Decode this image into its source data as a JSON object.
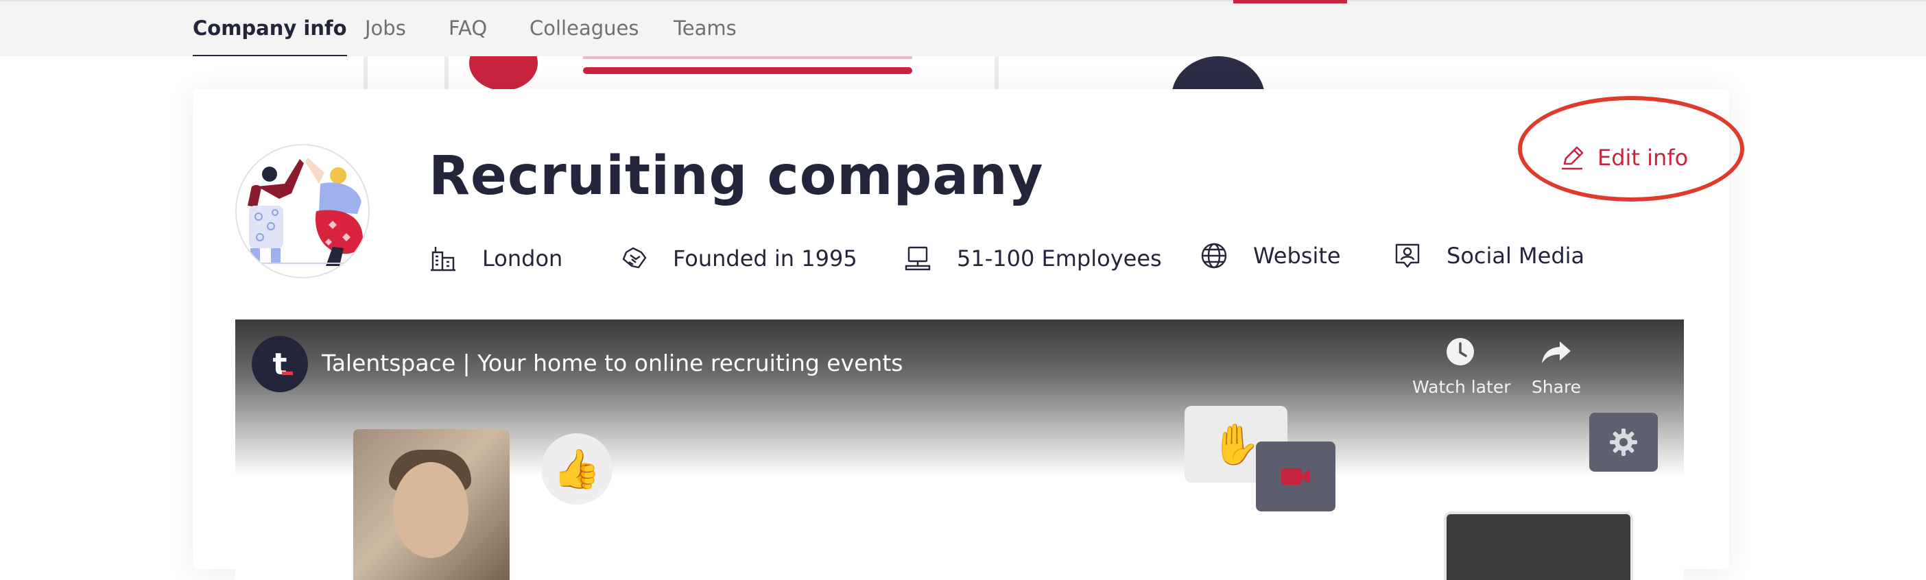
{
  "tabs": [
    {
      "label": "Company info",
      "active": true
    },
    {
      "label": "Jobs",
      "active": false
    },
    {
      "label": "FAQ",
      "active": false
    },
    {
      "label": "Colleagues",
      "active": false
    },
    {
      "label": "Teams",
      "active": false
    }
  ],
  "company": {
    "name": "Recruiting company",
    "location": "London",
    "founded": "Founded in 1995",
    "employees": "51-100 Employees",
    "website": "Website",
    "social_media": "Social Media",
    "edit_label": "Edit info"
  },
  "video": {
    "channel_initial": "t",
    "title": "Talentspace | Your home to online recruiting events",
    "watch_later_label": "Watch later",
    "share_label": "Share"
  },
  "colors": {
    "brand_red": "#c8243f",
    "navy": "#23253a",
    "annotation_red": "#e03a2d"
  },
  "icons": {
    "location": "building-icon",
    "founded": "handshake-icon",
    "employees": "monitor-icon",
    "website": "globe-icon",
    "social": "social-profile-icon",
    "edit": "pencil-icon"
  }
}
